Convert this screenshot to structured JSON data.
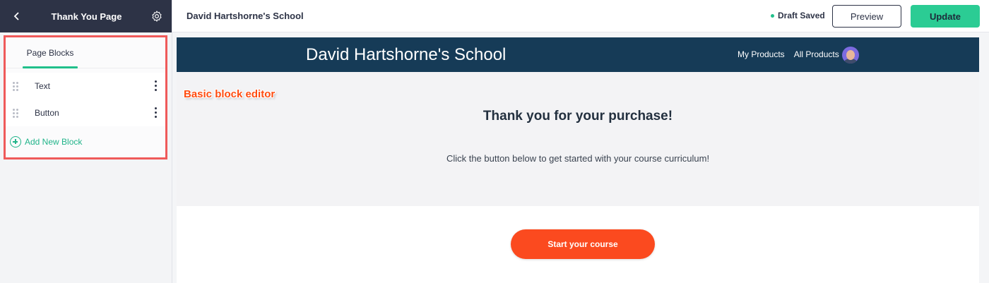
{
  "sidebar": {
    "title": "Thank You Page",
    "tab_label": "Page Blocks",
    "blocks": [
      {
        "label": "Text"
      },
      {
        "label": "Button"
      }
    ],
    "add_block_label": "Add New Block",
    "icons": {
      "back": "chevron-left-icon",
      "settings": "gear-icon"
    }
  },
  "topbar": {
    "school_name": "David Hartshorne's School",
    "status": "Draft Saved",
    "preview_label": "Preview",
    "update_label": "Update"
  },
  "site": {
    "name": "David Hartshorne's School",
    "nav": [
      "My Products",
      "All Products"
    ]
  },
  "content": {
    "annotation": "Basic block editor",
    "heading": "Thank you for your purchase!",
    "subtext": "Click the button below to get started with your course curriculum!",
    "cta_label": "Start your course"
  },
  "colors": {
    "sidebar_header": "#2d3346",
    "accent_green": "#21c08b",
    "highlight_border": "#ef5a5a",
    "site_header": "#163b57",
    "cta": "#fb4a1f"
  }
}
